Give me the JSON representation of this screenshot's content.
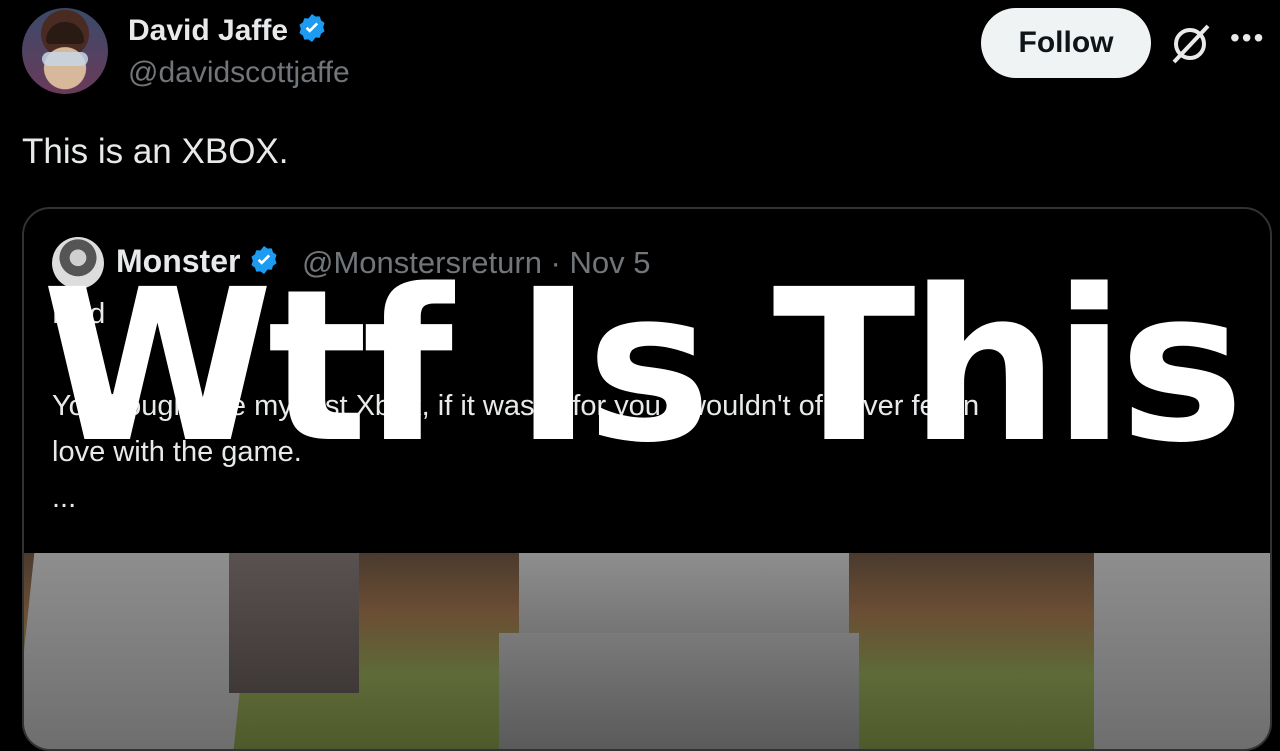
{
  "post": {
    "author_name": "David Jaffe",
    "author_handle": "@davidscottjaffe",
    "verified": true,
    "follow_label": "Follow",
    "more_label": "•••",
    "text": "This is an XBOX."
  },
  "quoted_post": {
    "author_name": "Monster",
    "author_handle": "@Monstersreturn · Nov 5",
    "verified": true,
    "lines": [
      "Dad",
      "",
      "You bought me my first Xbox, if it wasn't for you I wouldn't of never fell in",
      "love with the game.",
      "..."
    ]
  },
  "overlay": {
    "text": "Wtf Is This"
  },
  "colors": {
    "background": "#000000",
    "primary_text": "#e7e9ea",
    "secondary_text": "#71767b",
    "verified_blue": "#1d9bf0",
    "follow_bg": "#eff3f4"
  },
  "icons": {
    "verified": "verified-badge-icon",
    "grok": "grok-icon",
    "more": "more-options-icon"
  }
}
